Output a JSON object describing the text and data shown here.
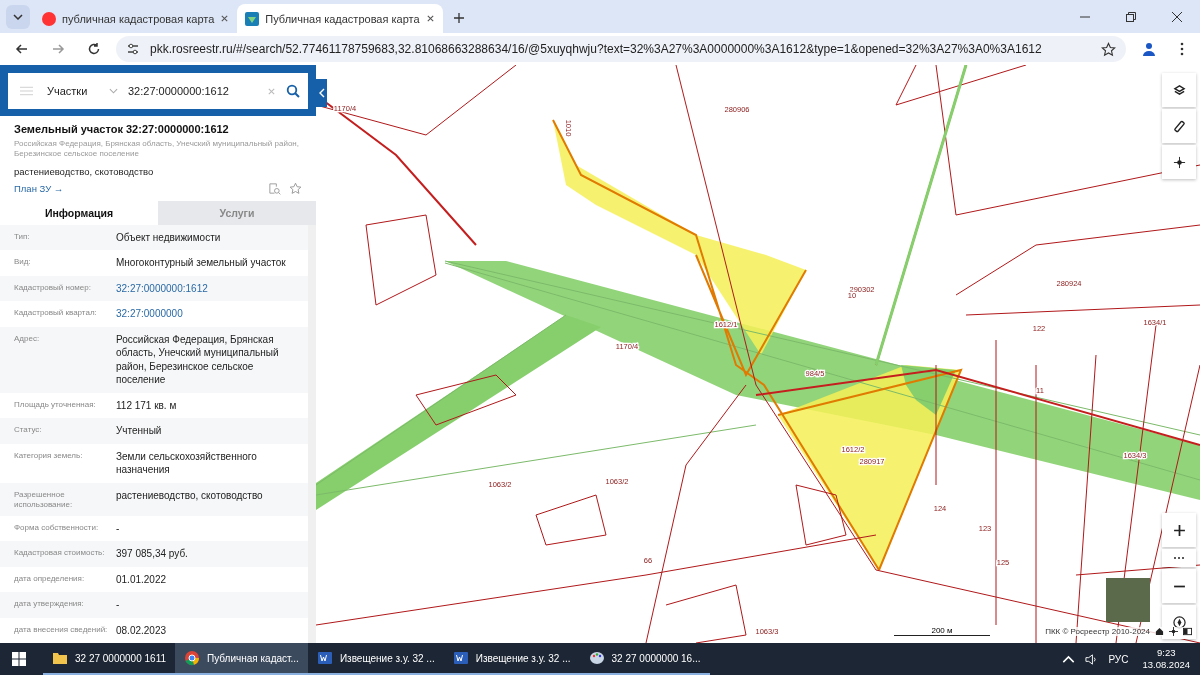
{
  "browser": {
    "tabs": [
      {
        "title": "публичная кадастровая карта",
        "kind": "yandex",
        "selected": false
      },
      {
        "title": "Публичная кадастровая карта",
        "kind": "site",
        "selected": true
      }
    ],
    "url": "pkk.rosreestr.ru/#/search/52.77461178759683,32.81068663288634/16/@5xuyqhwju?text=32%3A27%3A0000000%3A1612&type=1&opened=32%3A27%3A0%3A1612"
  },
  "panel": {
    "search": {
      "category": "Участки",
      "value": "32:27:0000000:1612"
    },
    "object": {
      "title": "Земельный участок 32:27:0000000:1612",
      "address": "Российская Федерация, Брянская область, Унечский муниципальный район, Березинское сельское поселение",
      "usage": "растениеводство, скотоводство",
      "link": "План ЗУ →"
    },
    "tabs": [
      {
        "label": "Информация",
        "selected": true
      },
      {
        "label": "Услуги",
        "selected": false
      }
    ],
    "rows": [
      {
        "label": "Тип:",
        "value": "Объект недвижимости",
        "kind": "text"
      },
      {
        "label": "Вид:",
        "value": "Многоконтурный земельный участок",
        "kind": "text"
      },
      {
        "label": "Кадастровый номер:",
        "value": "32:27:0000000:1612",
        "kind": "link"
      },
      {
        "label": "Кадастровый квартал:",
        "value": "32:27:0000000",
        "kind": "link"
      },
      {
        "label": "Адрес:",
        "value": "Российская Федерация, Брянская область, Унечский муниципальный район, Березинское сельское поселение",
        "kind": "text"
      },
      {
        "label": "Площадь уточненная:",
        "value": "112 171 кв. м",
        "kind": "text"
      },
      {
        "label": "Статус:",
        "value": "Учтенный",
        "kind": "text"
      },
      {
        "label": "Категория земель:",
        "value": "Земли сельскохозяйственного назначения",
        "kind": "text"
      },
      {
        "label": "Разрешенное использование:",
        "value": "растениеводство, скотоводство",
        "kind": "text"
      },
      {
        "label": "Форма собственности:",
        "value": "-",
        "kind": "text"
      },
      {
        "label": "Кадастровая стоимость:",
        "value": "397 085,34 руб.",
        "kind": "text"
      },
      {
        "label": "дата определения:",
        "value": "01.01.2022",
        "kind": "text"
      },
      {
        "label": "дата утверждения:",
        "value": "-",
        "kind": "text"
      },
      {
        "label": "дата внесения сведений:",
        "value": "08.02.2023",
        "kind": "text"
      }
    ]
  },
  "map": {
    "labels": [
      "1170/4",
      "1010",
      "280906",
      "290302",
      "280924",
      "1612/1",
      "10",
      "122",
      "1634/1",
      "1170/4",
      "984/5",
      "11",
      "1612/2",
      "280917",
      "1634/3",
      "1063/2",
      "1063/2",
      "124",
      "123",
      "125",
      "66",
      "1063/3"
    ],
    "scale": "200 м",
    "attribution": "ПКК © Росреестр 2010-2024"
  },
  "taskbar": {
    "items": [
      {
        "label": "32 27 0000000 1611",
        "kind": "folder",
        "selected": false
      },
      {
        "label": "Публичная кадаст...",
        "kind": "chrome",
        "selected": true
      },
      {
        "label": "Извещение з.у. 32 ...",
        "kind": "word",
        "selected": false
      },
      {
        "label": "Извещение з.у. 32 ...",
        "kind": "word",
        "selected": false
      },
      {
        "label": "32  27  0000000  16...",
        "kind": "paint",
        "selected": false
      }
    ],
    "lang": "РУС",
    "time": "9:23",
    "date": "13.08.2024"
  }
}
